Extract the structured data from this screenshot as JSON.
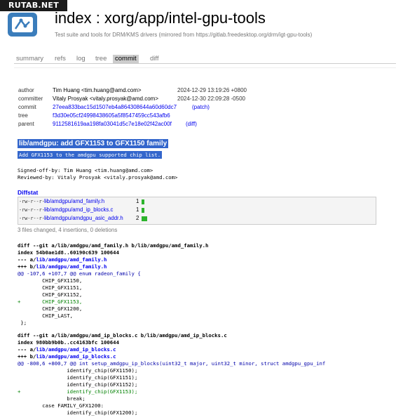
{
  "watermark": "RUTAB.NET",
  "header": {
    "title": "index : xorg/app/intel-gpu-tools",
    "description": "Test suite and tools for DRM/KMS drivers (mirrored from https://gitlab.freedesktop.org/drm/igt-gpu-tools)"
  },
  "tabs": [
    {
      "label": "summary"
    },
    {
      "label": "refs"
    },
    {
      "label": "log"
    },
    {
      "label": "tree"
    },
    {
      "label": "commit",
      "active": true
    },
    {
      "label": "diff"
    }
  ],
  "commit_info": {
    "author": {
      "label": "author",
      "value": "Tim Huang <tim.huang@amd.com>",
      "date": "2024-12-29 13:19:26 +0800"
    },
    "committer": {
      "label": "committer",
      "value": "Vitaly Prosyak <vitaly.prosyak@amd.com>",
      "date": "2024-12-30 22:09:28 -0500"
    },
    "commit": {
      "label": "commit",
      "hash": "27eea833bac15d1507eb4a864308644a60d60dc7",
      "extra": "(patch)"
    },
    "tree": {
      "label": "tree",
      "hash": "f3d30e05cf24998438605a5f8547459cc543afb6"
    },
    "parent": {
      "label": "parent",
      "hash": "9112581619aa198fa03041d5c7e18e02f42ac00f",
      "extra": "(diff)"
    }
  },
  "commit_subject": "lib/amdgpu: add GFX1153 to GFX1150 family",
  "commit_message": "Add GFX1153 to the amdgpu supported chip list.",
  "signoffs": [
    "Signed-off-by: Tim Huang <tim.huang@amd.com>",
    "Reviewed-by: Vitaly Prosyak <vitaly.prosyak@amd.com>"
  ],
  "diffstat": {
    "title": "Diffstat",
    "rows": [
      {
        "mode": "-rw-r--r--",
        "file": "lib/amdgpu/amd_family.h",
        "count": "1",
        "bar": 1
      },
      {
        "mode": "-rw-r--r--",
        "file": "lib/amdgpu/amd_ip_blocks.c",
        "count": "1",
        "bar": 1
      },
      {
        "mode": "-rw-r--r--",
        "file": "lib/amdgpu/amdgpu_asic_addr.h",
        "count": "2",
        "bar": 2
      }
    ],
    "summary": "3 files changed, 4 insertions, 0 deletions"
  },
  "diff1": {
    "header": "diff --git a/lib/amdgpu/amd_family.h b/lib/amdgpu/amd_family.h",
    "index": "index 54b0ae1d8..60190c639 100644",
    "minus_prefix": "--- a/",
    "minus_file": "lib/amdgpu/amd_family.h",
    "plus_prefix": "+++ b/",
    "plus_file": "lib/amdgpu/amd_family.h",
    "hunk": "@@ -107,6 +107,7 @@ enum radeon_family {",
    "lines": [
      {
        "t": " ",
        "text": "        CHIP_GFX1150,"
      },
      {
        "t": " ",
        "text": "        CHIP_GFX1151,"
      },
      {
        "t": " ",
        "text": "        CHIP_GFX1152,"
      },
      {
        "t": "+",
        "text": "+       CHIP_GFX1153,"
      },
      {
        "t": " ",
        "text": "        CHIP_GFX1200,"
      },
      {
        "t": " ",
        "text": "        CHIP_LAST,"
      },
      {
        "t": " ",
        "text": " };"
      }
    ]
  },
  "diff2": {
    "header": "diff --git a/lib/amdgpu/amd_ip_blocks.c b/lib/amdgpu/amd_ip_blocks.c",
    "index": "index 980bb9b0b..cc4163bfc 100644",
    "minus_prefix": "--- a/",
    "minus_file": "lib/amdgpu/amd_ip_blocks.c",
    "plus_prefix": "+++ b/",
    "plus_file": "lib/amdgpu/amd_ip_blocks.c",
    "hunk": "@@ -800,6 +800,7 @@ int setup_amdgpu_ip_blocks(uint32_t major, uint32_t minor, struct amdgpu_gpu_inf",
    "lines": [
      {
        "t": " ",
        "text": "                identify_chip(GFX1150);"
      },
      {
        "t": " ",
        "text": "                identify_chip(GFX1151);"
      },
      {
        "t": " ",
        "text": "                identify_chip(GFX1152);"
      },
      {
        "t": "+",
        "text": "+               identify_chip(GFX1153);"
      },
      {
        "t": " ",
        "text": "                break;"
      },
      {
        "t": " ",
        "text": "        case FAMILY_GFX1200:"
      },
      {
        "t": " ",
        "text": "                identify_chip(GFX1200);"
      }
    ]
  }
}
